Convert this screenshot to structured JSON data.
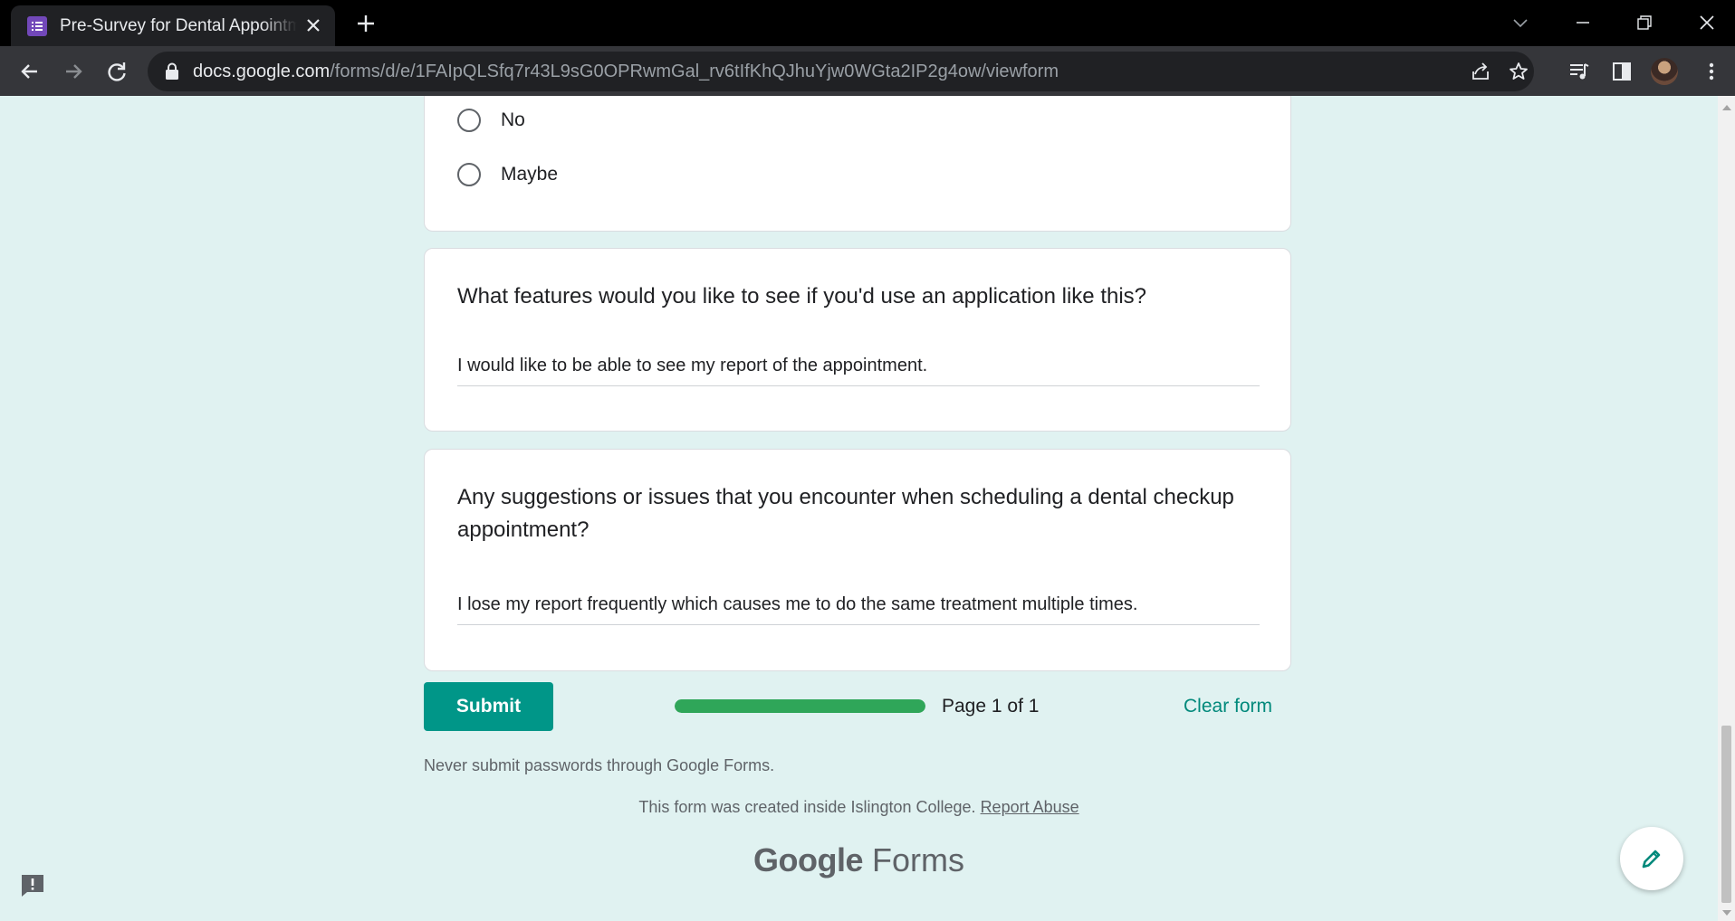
{
  "browser": {
    "tab_title": "Pre-Survey for Dental Appointment",
    "url_host": "docs.google.com",
    "url_path": "/forms/d/e/1FAIpQLSfq7r43L9sG0OPRwmGal_rv6tIfKhQJhuYjw0WGta2IP2g4ow/viewform"
  },
  "question_prev": {
    "options": [
      "No",
      "Maybe"
    ]
  },
  "question_features": {
    "title": "What features would you like to see if you'd use an application like this?",
    "answer": "I would like to be able to see my report of the appointment."
  },
  "question_suggestions": {
    "title": "Any suggestions or issues that you encounter when scheduling a dental checkup appointment?",
    "answer": "I lose my report frequently which causes me to do the same treatment multiple times."
  },
  "form_footer": {
    "submit_label": "Submit",
    "progress_fraction": 1.0,
    "page_label": "Page 1 of 1",
    "clear_label": "Clear form",
    "warning": "Never submit passwords through Google Forms.",
    "created_note": "This form was created inside Islington College.",
    "report_label": "Report Abuse",
    "brand_google": "Google",
    "brand_forms": "Forms"
  },
  "colors": {
    "page_bg": "#e0f2f1",
    "accent": "#009688",
    "progress": "#2fa659"
  },
  "icons": [
    "forms-favicon-icon",
    "close-icon",
    "plus-icon",
    "back-icon",
    "forward-icon",
    "reload-icon",
    "lock-icon",
    "share-icon",
    "star-icon",
    "media-icon",
    "sidepanel-icon",
    "edit-icon",
    "feedback-icon"
  ]
}
